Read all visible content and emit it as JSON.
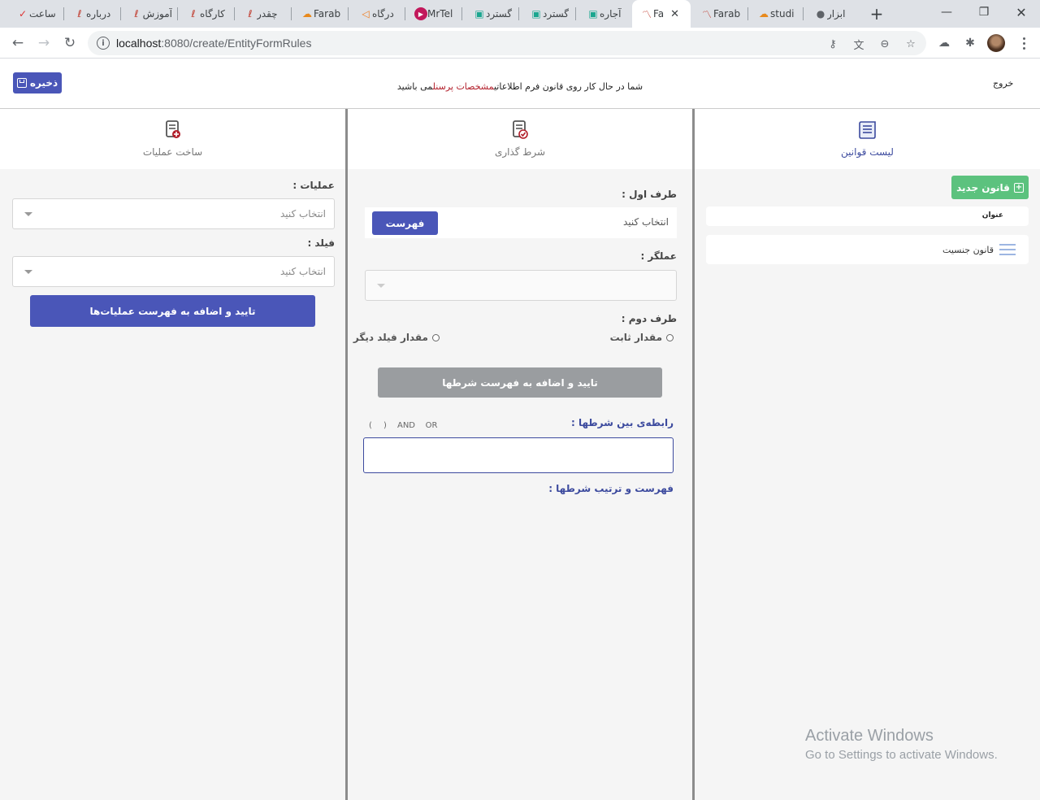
{
  "browser": {
    "tabs": [
      {
        "title": "ساعت",
        "icon": "check-icon"
      },
      {
        "title": "درباره",
        "icon": "scribble-icon"
      },
      {
        "title": "آموزش",
        "icon": "scribble-icon"
      },
      {
        "title": "کارگاه",
        "icon": "scribble-icon"
      },
      {
        "title": "چقدر",
        "icon": "scribble-icon"
      },
      {
        "title": "Farab",
        "icon": "cloud-icon"
      },
      {
        "title": "درگاه",
        "icon": "play-icon"
      },
      {
        "title": "MrTel",
        "icon": "mrtel-icon"
      },
      {
        "title": "گسترد",
        "icon": "robot-icon"
      },
      {
        "title": "گسترد",
        "icon": "robot-icon"
      },
      {
        "title": "آجاره",
        "icon": "robot-icon"
      },
      {
        "title": "Fa",
        "icon": "chart-icon",
        "active": true
      },
      {
        "title": "Farab",
        "icon": "chart-icon"
      },
      {
        "title": "studi",
        "icon": "cloud-icon"
      },
      {
        "title": "ابزار",
        "icon": "globe-icon"
      }
    ],
    "url_host": "localhost",
    "url_path": ":8080/create/EntityFormRules"
  },
  "header": {
    "save_label": "ذخیره",
    "msg_prefix": "شما در حال کار روی قانون فرم اطلاعاتی",
    "msg_entity": "مشخصات پرسنل",
    "msg_suffix": "می باشید",
    "logout_label": "خروج"
  },
  "columns": {
    "operations": {
      "title": "ساخت عملیات",
      "op_label": "عملیات :",
      "op_placeholder": "انتخاب کنید",
      "field_label": "فیلد :",
      "field_placeholder": "انتخاب کنید",
      "confirm_label": "تایید و اضافه به فهرست عملیات‌ها"
    },
    "conditions": {
      "title": "شرط گذاری",
      "first_side_label": "طرف اول :",
      "first_side_placeholder": "انتخاب کنید",
      "list_button": "فهرست",
      "operator_label": "عملگر :",
      "second_side_label": "طرف دوم :",
      "radio_constant": "مقدار ثابت",
      "radio_other_field": "مقدار فیلد دیگر",
      "confirm_label": "تایید و اضافه به فهرست شرطها",
      "relation_label": "رابطه‌ی بین شرطها :",
      "op_or": "OR",
      "op_and": "AND",
      "op_paren_close": ")",
      "op_paren_open": "(",
      "relation_value": "",
      "order_label": "فهرست و ترتیب شرطها :"
    },
    "rules": {
      "title": "لیست قوانین",
      "new_rule_label": "قانون جدید",
      "table_header": "عنوان",
      "items": [
        "قانون جنسیت"
      ]
    }
  },
  "watermark": {
    "line1": "Activate Windows",
    "line2": "Go to Settings to activate Windows."
  },
  "colors": {
    "primary": "#4a56b8",
    "success": "#5cc27e",
    "accent_red": "#b21e2a",
    "gray_button": "#9a9da0"
  }
}
